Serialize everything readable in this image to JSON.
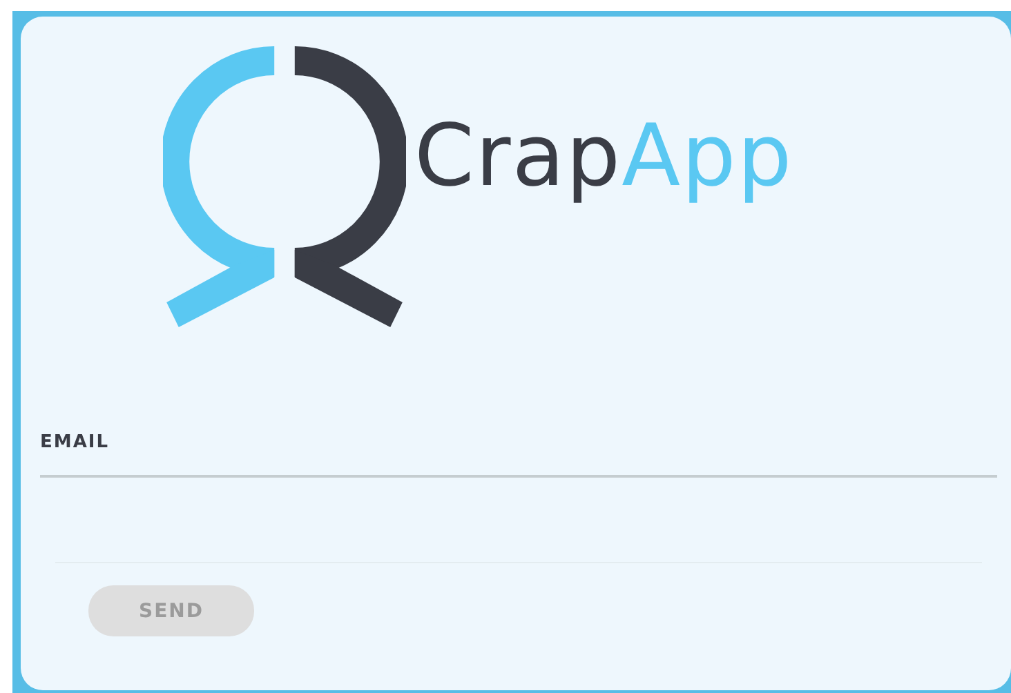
{
  "logo": {
    "parts": [
      {
        "text": "Crap",
        "color": "#3a3d46"
      },
      {
        "text": "App",
        "color": "#5ac8f2"
      }
    ]
  },
  "email_field": {
    "label": "EMAIL"
  },
  "send_button": {
    "label": "SEND",
    "disabled": true
  }
}
